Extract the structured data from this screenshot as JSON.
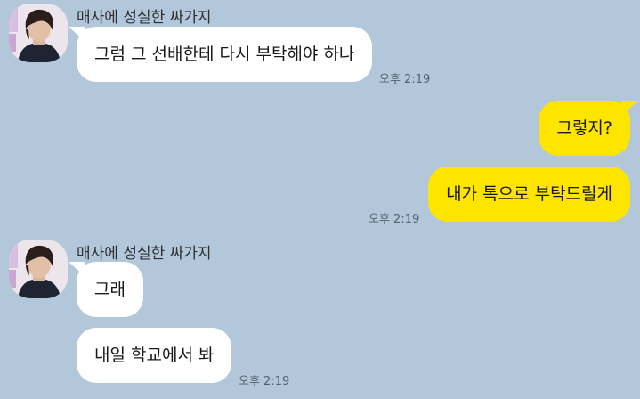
{
  "colors": {
    "background": "#b2c7d9",
    "incoming_bubble": "#ffffff",
    "outgoing_bubble": "#fee500"
  },
  "groups": [
    {
      "sender": "매사에 성실한 싸가지",
      "avatar_icon": "profile-photo-icon",
      "messages": [
        "그럼 그 선배한테 다시 부탁해야 하나"
      ],
      "time": "오후 2:19"
    },
    {
      "sender": "",
      "messages": [
        "그렇지?",
        "내가 톡으로 부탁드릴게"
      ],
      "time": "오후 2:19"
    },
    {
      "sender": "매사에 성실한 싸가지",
      "avatar_icon": "profile-photo-icon",
      "messages": [
        "그래",
        "내일 학교에서 봐"
      ],
      "time": "오후 2:19"
    }
  ]
}
